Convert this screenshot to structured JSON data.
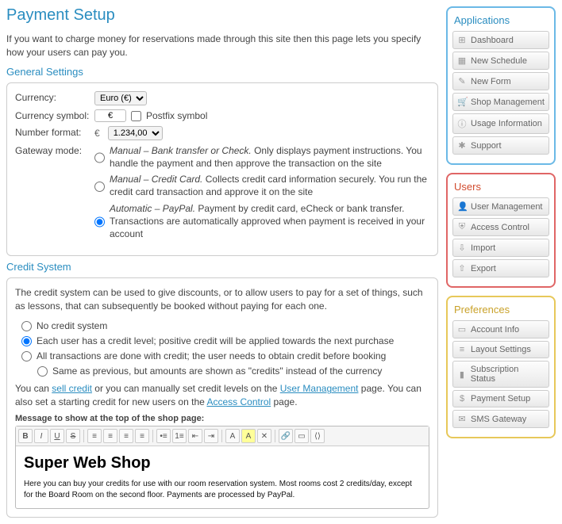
{
  "header": {
    "title": "Payment Setup"
  },
  "intro": "If you want to charge money for reservations made through this site then this page lets you specify how your users can pay you.",
  "general": {
    "title": "General Settings",
    "currency_label": "Currency:",
    "currency_options": [
      "Euro (€)"
    ],
    "currency_value": "Euro (€)",
    "symbol_label": "Currency symbol:",
    "symbol_value": "€",
    "postfix_label": "Postfix symbol",
    "postfix_checked": false,
    "number_label": "Number format:",
    "number_prefix": "€",
    "number_options": [
      "1.234,00"
    ],
    "number_value": "1.234,00",
    "gateway_label": "Gateway mode:",
    "gateway_options": [
      {
        "title": "Manual – Bank transfer or Check.",
        "desc": " Only displays payment instructions. You handle the payment and then approve the transaction on the site",
        "checked": false
      },
      {
        "title": "Manual – Credit Card.",
        "desc": " Collects credit card information securely. You run the credit card transaction and approve it on the site",
        "checked": false
      },
      {
        "title": "Automatic – PayPal.",
        "desc": " Payment by credit card, eCheck or bank transfer. Transactions are automatically approved when payment is received in your account",
        "checked": true
      }
    ]
  },
  "credit": {
    "title": "Credit System",
    "intro": "The credit system can be used to give discounts, or to allow users to pay for a set of things, such as lessons, that can subsequently be booked without paying for each one.",
    "options": [
      {
        "label": "No credit system",
        "checked": false,
        "indent": false
      },
      {
        "label": "Each user has a credit level; positive credit will be applied towards the next purchase",
        "checked": true,
        "indent": false
      },
      {
        "label": "All transactions are done with credit; the user needs to obtain credit before booking",
        "checked": false,
        "indent": false
      },
      {
        "label": "Same as previous, but amounts are shown as \"credits\" instead of the currency",
        "checked": false,
        "indent": true
      }
    ],
    "note_a": "You can ",
    "link_sell": "sell credit",
    "note_b": " or you can manually set credit levels on the ",
    "link_um": "User Management",
    "note_c": " page. You can also set a starting credit for new users on the ",
    "link_ac": "Access Control",
    "note_d": " page.",
    "editor_label": "Message to show at the top of the shop page:",
    "editor_heading": "Super Web Shop",
    "editor_body": "Here you can buy your credits for use with our room reservation system. Most rooms cost 2 credits/day, except for the Board Room on the second floor. Payments are processed by PayPal."
  },
  "sidebar": {
    "applications": {
      "title": "Applications",
      "items": [
        {
          "icon": "⊞",
          "label": "Dashboard",
          "name": "app-dashboard"
        },
        {
          "icon": "▦",
          "label": "New Schedule",
          "name": "app-new-schedule"
        },
        {
          "icon": "✎",
          "label": "New Form",
          "name": "app-new-form"
        },
        {
          "icon": "🛒",
          "label": "Shop Management",
          "name": "app-shop-management"
        },
        {
          "icon": "ⓘ",
          "label": "Usage Information",
          "name": "app-usage-information"
        },
        {
          "icon": "✱",
          "label": "Support",
          "name": "app-support"
        }
      ]
    },
    "users": {
      "title": "Users",
      "items": [
        {
          "icon": "👤",
          "label": "User Management",
          "name": "users-user-management"
        },
        {
          "icon": "⛨",
          "label": "Access Control",
          "name": "users-access-control"
        },
        {
          "icon": "⇩",
          "label": "Import",
          "name": "users-import"
        },
        {
          "icon": "⇧",
          "label": "Export",
          "name": "users-export"
        }
      ]
    },
    "preferences": {
      "title": "Preferences",
      "items": [
        {
          "icon": "▭",
          "label": "Account Info",
          "name": "pref-account-info"
        },
        {
          "icon": "≡",
          "label": "Layout Settings",
          "name": "pref-layout-settings"
        },
        {
          "icon": "▮",
          "label": "Subscription Status",
          "name": "pref-subscription-status"
        },
        {
          "icon": "$",
          "label": "Payment Setup",
          "name": "pref-payment-setup"
        },
        {
          "icon": "✉",
          "label": "SMS Gateway",
          "name": "pref-sms-gateway"
        }
      ]
    }
  }
}
